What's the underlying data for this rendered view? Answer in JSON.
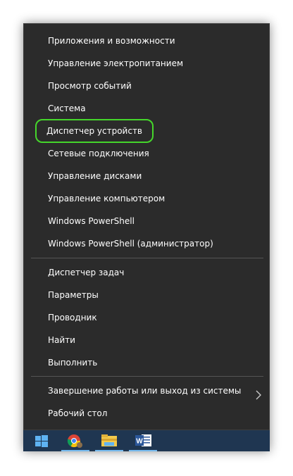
{
  "menu": {
    "items": [
      {
        "label": "Приложения и возможности"
      },
      {
        "label": "Управление электропитанием"
      },
      {
        "label": "Просмотр событий"
      },
      {
        "label": "Система"
      },
      {
        "label": "Диспетчер устройств",
        "highlighted": true
      },
      {
        "label": "Сетевые подключения"
      },
      {
        "label": "Управление дисками"
      },
      {
        "label": "Управление компьютером"
      },
      {
        "label": "Windows PowerShell"
      },
      {
        "label": "Windows PowerShell (администратор)"
      },
      {
        "label": "Диспетчер задач"
      },
      {
        "label": "Параметры"
      },
      {
        "label": "Проводник"
      },
      {
        "label": "Найти"
      },
      {
        "label": "Выполнить"
      },
      {
        "label": "Завершение работы или выход из системы",
        "has_submenu": true
      },
      {
        "label": "Рабочий стол"
      }
    ]
  },
  "taskbar": {
    "buttons": [
      {
        "icon": "windows-start-icon"
      },
      {
        "icon": "chrome-icon"
      },
      {
        "icon": "file-explorer-icon"
      },
      {
        "icon": "word-icon"
      }
    ]
  },
  "colors": {
    "menu_bg": "#2b2b2b",
    "taskbar_bg": "#1f3651",
    "highlight_outline": "#45d62b",
    "accent": "#76b9ed"
  }
}
